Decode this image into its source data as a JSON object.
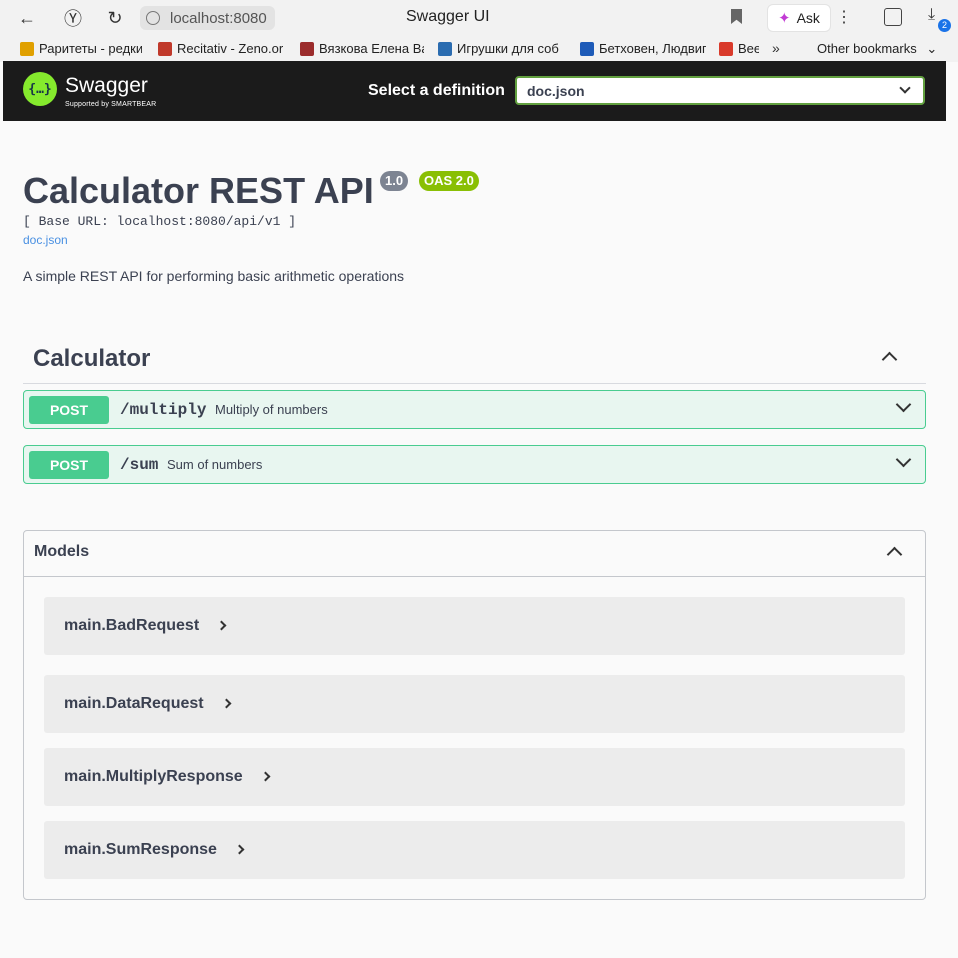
{
  "browser": {
    "address": "localhost:8080",
    "tab_title": "Swagger UI",
    "ask_label": "Ask",
    "download_count": "2",
    "bookmarks": [
      {
        "label": "Раритеты - редки",
        "color": "#e0a000"
      },
      {
        "label": "Recitativ - Zeno.or",
        "color": "#c0392b"
      },
      {
        "label": "Вязкова Елена Ва",
        "color": "#9b2c2c"
      },
      {
        "label": "Игрушки для соб",
        "color": "#2b6cb0"
      },
      {
        "label": "Бетховен, Людвиг",
        "color": "#1e5bb8"
      },
      {
        "label": "Bee",
        "color": "#d93a2b"
      }
    ],
    "more_label": "»",
    "other_bookmarks": "Other bookmarks"
  },
  "swagger": {
    "logo_text": "Swagger",
    "logo_sub": "Supported by SMARTBEAR",
    "select_label": "Select a definition",
    "selected_definition": "doc.json"
  },
  "info": {
    "title": "Calculator REST API",
    "version": "1.0",
    "oas": "OAS 2.0",
    "base_url": "[ Base URL: localhost:8080/api/v1 ]",
    "doc_link": "doc.json",
    "description": "A simple REST API for performing basic arithmetic operations"
  },
  "tag": {
    "name": "Calculator",
    "operations": [
      {
        "method": "POST",
        "path": "/multiply",
        "summary": "Multiply of numbers"
      },
      {
        "method": "POST",
        "path": "/sum",
        "summary": "Sum of numbers"
      }
    ]
  },
  "models": {
    "title": "Models",
    "items": [
      "main.BadRequest",
      "main.DataRequest",
      "main.MultiplyResponse",
      "main.SumResponse"
    ]
  },
  "colors": {
    "post": "#49cc90",
    "topbar": "#1b1b1b",
    "link": "#4990e2"
  }
}
